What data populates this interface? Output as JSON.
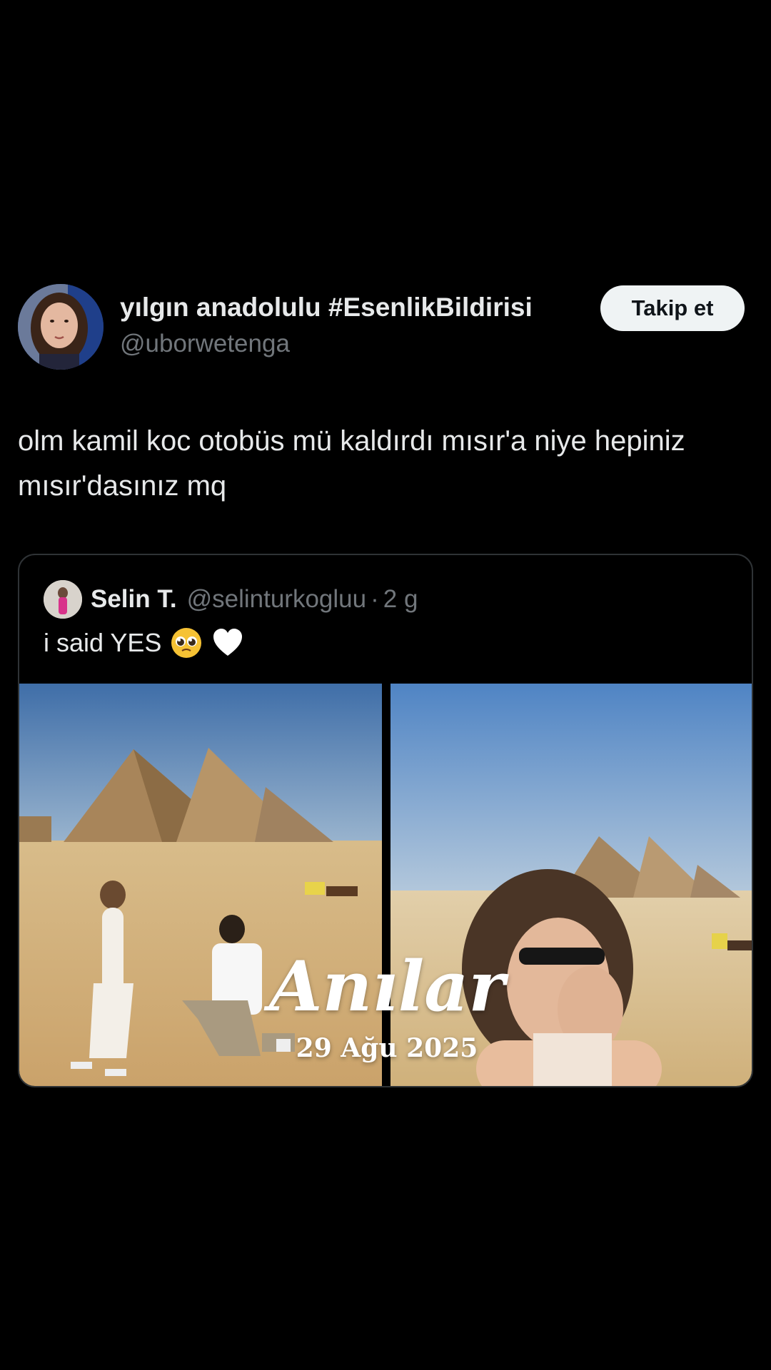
{
  "tweet": {
    "author": {
      "name": "yılgın anadolulu #EsenlikBildirisi",
      "handle": "@uborwetenga",
      "avatar_icon": "user-avatar"
    },
    "follow_label": "Takip et",
    "text": "olm kamil koc otobüs mü kaldırdı mısır'a niye hepiniz mısır'dasınız mq"
  },
  "quote": {
    "author": {
      "name": "Selin T.",
      "handle": "@selinturkogluu",
      "dot": "·",
      "time": "2 g",
      "avatar_icon": "quoted-user-avatar"
    },
    "text": "i said YES",
    "emojis": [
      "pleading-face-emoji",
      "white-heart-emoji"
    ],
    "media": {
      "photos": [
        {
          "name": "proposal-at-pyramids-photo"
        },
        {
          "name": "selfie-at-pyramids-photo"
        }
      ],
      "overlay_title": "Anılar",
      "overlay_date": "29 Ağu 2025"
    }
  },
  "colors": {
    "background": "#000000",
    "text_primary": "#e7e9ea",
    "text_secondary": "#71767b",
    "border": "#2f3336",
    "button_bg": "#eff3f4"
  }
}
